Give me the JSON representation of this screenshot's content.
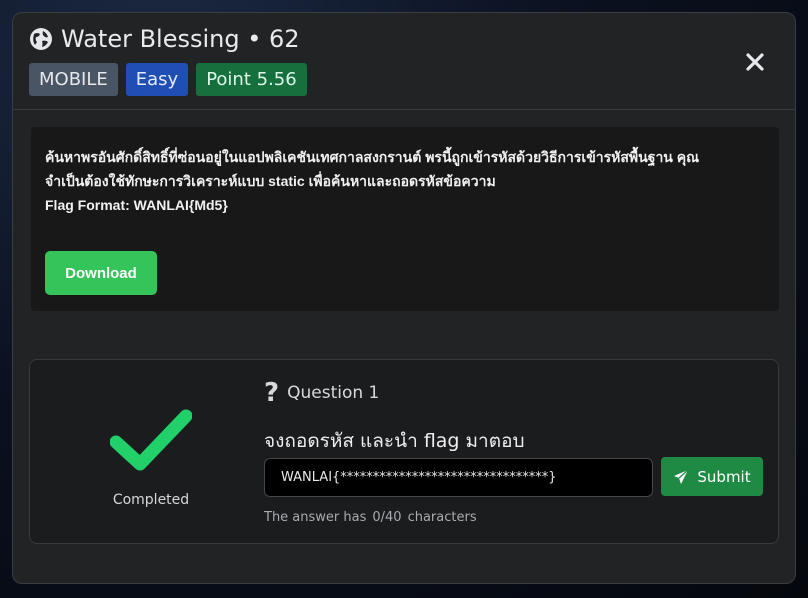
{
  "modal": {
    "title": "Water Blessing • 62",
    "badges": {
      "category": "MOBILE",
      "difficulty": "Easy",
      "points": "Point 5.56"
    },
    "description": {
      "line1": "ค้นหาพรอันศักดิ์สิทธิ์ที่ซ่อนอยู่ในแอปพลิเคชันเทศกาลสงกรานต์ พรนี้ถูกเข้ารหัสด้วยวิธีการเข้ารหัสพื้นฐาน คุณ",
      "line2": "จำเป็นต้องใช้ทักษะการวิเคราะห์แบบ static เพื่อค้นหาและถอดรหัสข้อความ",
      "line3": "Flag Format: WANLAI{Md5}"
    },
    "download_label": "Download"
  },
  "question": {
    "status_label": "Completed",
    "title": "Question 1",
    "prompt": "จงถอดรหัส และนำ flag มาตอบ",
    "answer_value": "WANLAI{********************************}",
    "submit_label": "Submit",
    "counter_prefix": "The answer has",
    "counter_value": "0/40",
    "counter_suffix": "characters"
  },
  "colors": {
    "category": "#495464",
    "difficulty": "#1f4fb5",
    "points": "#16703e",
    "download": "#35c45a",
    "check": "#22d06a",
    "submit": "#1e8a44"
  },
  "icons": [
    "globe-icon",
    "close-icon",
    "checkmark-icon",
    "question-icon",
    "send-icon"
  ]
}
